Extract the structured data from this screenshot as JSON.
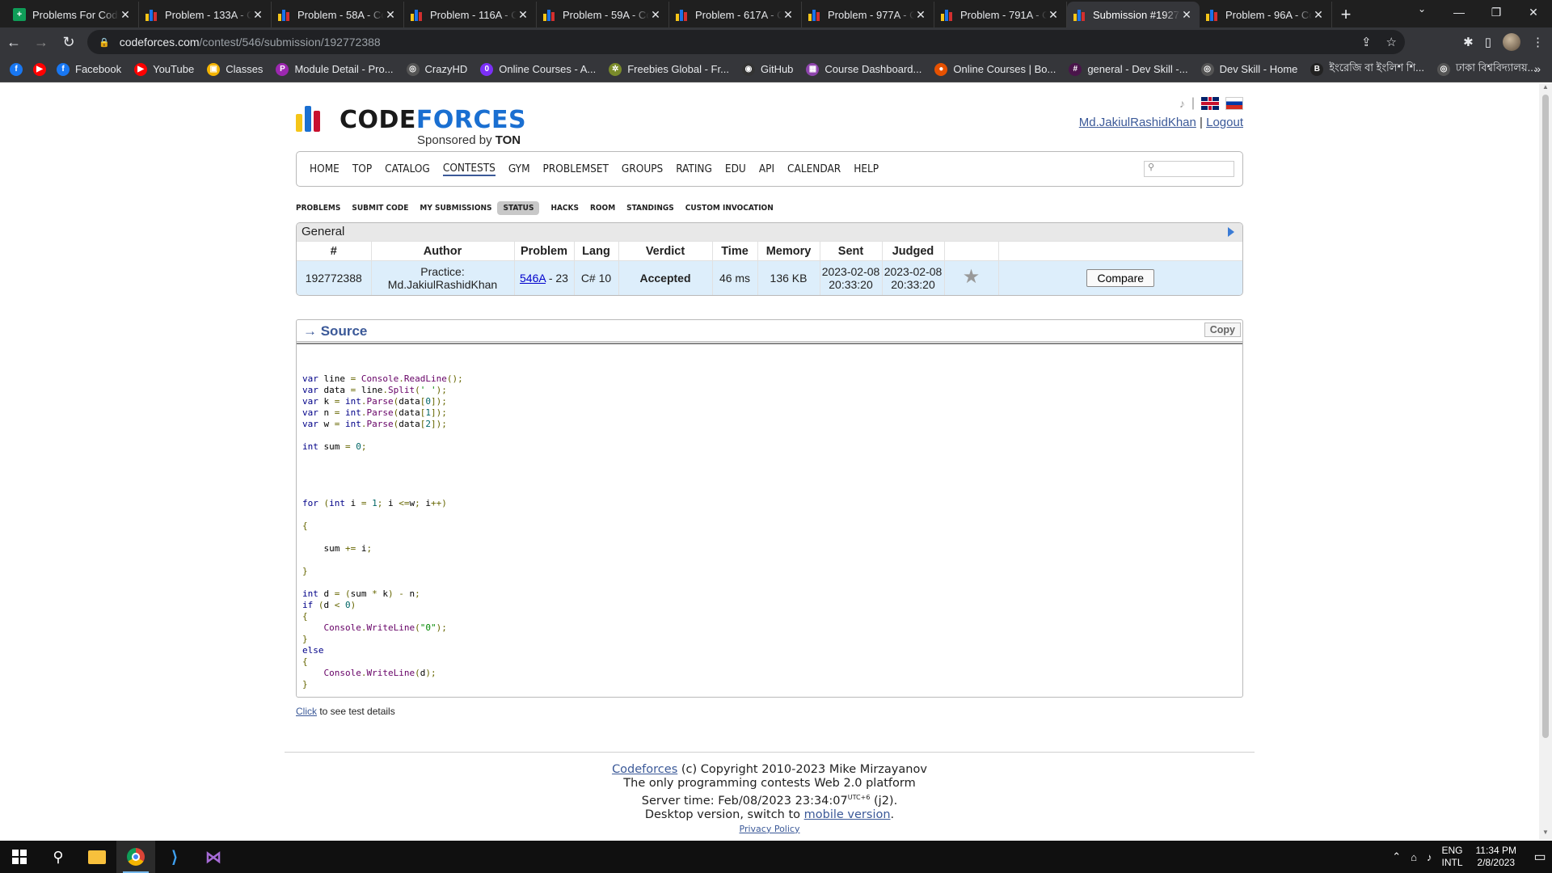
{
  "browser": {
    "tabs": [
      {
        "title": "Problems For Codin",
        "fav": "sheet"
      },
      {
        "title": "Problem - 133A - Co",
        "fav": "cf"
      },
      {
        "title": "Problem - 58A - Co",
        "fav": "cf"
      },
      {
        "title": "Problem - 116A - Co",
        "fav": "cf"
      },
      {
        "title": "Problem - 59A - Co",
        "fav": "cf"
      },
      {
        "title": "Problem - 617A - Co",
        "fav": "cf"
      },
      {
        "title": "Problem - 977A - Co",
        "fav": "cf"
      },
      {
        "title": "Problem - 791A - Co",
        "fav": "cf"
      },
      {
        "title": "Submission #19277",
        "fav": "cf",
        "active": true
      },
      {
        "title": "Problem - 96A - Co",
        "fav": "cf"
      }
    ],
    "url_host": "codeforces.com",
    "url_path": "/contest/546/submission/192772388",
    "bookmarks": [
      {
        "label": "",
        "icon": "facebook-icon",
        "color": "#1877f2",
        "glyph": "f"
      },
      {
        "label": "",
        "icon": "youtube-icon",
        "color": "#ff0000",
        "glyph": "▶"
      },
      {
        "label": "Facebook",
        "icon": "facebook-icon",
        "color": "#1877f2",
        "glyph": "f"
      },
      {
        "label": "YouTube",
        "icon": "youtube-icon",
        "color": "#ff0000",
        "glyph": "▶"
      },
      {
        "label": "Classes",
        "icon": "classroom-icon",
        "color": "#f4b400",
        "glyph": "▣"
      },
      {
        "label": "Module Detail - Pro...",
        "icon": "module-icon",
        "color": "#9c27b0",
        "glyph": "P"
      },
      {
        "label": "CrazyHD",
        "icon": "globe-icon",
        "color": "#555",
        "glyph": "◎"
      },
      {
        "label": "Online Courses - A...",
        "icon": "courses-icon",
        "color": "#7b2ff7",
        "glyph": "0"
      },
      {
        "label": "Freebies Global - Fr...",
        "icon": "gear-icon",
        "color": "#7a8b2a",
        "glyph": "✲"
      },
      {
        "label": "GitHub",
        "icon": "github-icon",
        "color": "#333",
        "glyph": "◉"
      },
      {
        "label": "Course Dashboard...",
        "icon": "dashboard-icon",
        "color": "#8e44ad",
        "glyph": "▦"
      },
      {
        "label": "Online Courses | Bo...",
        "icon": "courses-icon",
        "color": "#e65100",
        "glyph": "●"
      },
      {
        "label": "general - Dev Skill -...",
        "icon": "slack-icon",
        "color": "#4a154b",
        "glyph": "#"
      },
      {
        "label": "Dev Skill - Home",
        "icon": "globe-icon",
        "color": "#555",
        "glyph": "◎"
      },
      {
        "label": "ইংরেজি বা ইংলিশ শি...",
        "icon": "b-icon",
        "color": "#222",
        "glyph": "B"
      },
      {
        "label": "ঢাকা বিশ্ববিদ্যালয়...",
        "icon": "globe-icon",
        "color": "#555",
        "glyph": "◎"
      }
    ]
  },
  "header": {
    "logo_code": "CODE",
    "logo_forces": "FORCES",
    "sponsored_prefix": "Sponsored by ",
    "sponsored_brand": "TON",
    "username": "Md.JakiulRashidKhan",
    "separator": "|",
    "logout": "Logout"
  },
  "menu": {
    "items": [
      "HOME",
      "TOP",
      "CATALOG",
      "CONTESTS",
      "GYM",
      "PROBLEMSET",
      "GROUPS",
      "RATING",
      "EDU",
      "API",
      "CALENDAR",
      "HELP"
    ],
    "current": "CONTESTS"
  },
  "submenu": {
    "items": [
      "PROBLEMS",
      "SUBMIT CODE",
      "MY SUBMISSIONS",
      "STATUS",
      "HACKS",
      "ROOM",
      "STANDINGS",
      "CUSTOM INVOCATION"
    ],
    "current": "STATUS"
  },
  "general": {
    "caption": "General",
    "columns": [
      "#",
      "Author",
      "Problem",
      "Lang",
      "Verdict",
      "Time",
      "Memory",
      "Sent",
      "Judged",
      "",
      ""
    ],
    "row": {
      "id": "192772388",
      "author_prefix": "Practice:",
      "author": "Md.JakiulRashidKhan",
      "problem_link": "546A",
      "problem_suffix": " - 23",
      "lang": "C# 10",
      "verdict": "Accepted",
      "time": "46 ms",
      "memory": "136 KB",
      "sent_date": "2023-02-08",
      "sent_time": "20:33:20",
      "judged_date": "2023-02-08",
      "judged_time": "20:33:20",
      "compare": "Compare"
    }
  },
  "source": {
    "title": "→ Source",
    "copy": "Copy",
    "code": "\n\nvar line = Console.ReadLine();\nvar data = line.Split(' ');\nvar k = int.Parse(data[0]);\nvar n = int.Parse(data[1]);\nvar w = int.Parse(data[2]);\n\nint sum = 0;\n\n\n\n\nfor (int i = 1; i <=w; i++)\n\n{\n\n    sum += i;\n\n}\n\nint d = (sum * k) - n;\nif (d < 0)\n{\n    Console.WriteLine(\"0\");\n}\nelse\n{\n    Console.WriteLine(d);\n}"
  },
  "test_details": {
    "link": "Click",
    "text": " to see test details"
  },
  "footer": {
    "site": "Codeforces",
    "copyright": " (c) Copyright 2010-2023 Mike Mirzayanov",
    "line2": "The only programming contests Web 2.0 platform",
    "server_time_label": "Server time: Feb/08/2023 23:34:07",
    "tz": "UTC+6",
    "server_suffix": " (j2).",
    "desktop_prefix": "Desktop version, switch to ",
    "mobile_link": "mobile version",
    "desktop_suffix": ".",
    "privacy": "Privacy Policy"
  },
  "taskbar": {
    "lang_top": "ENG",
    "lang_bottom": "INTL",
    "time": "11:34 PM",
    "date": "2/8/2023"
  }
}
